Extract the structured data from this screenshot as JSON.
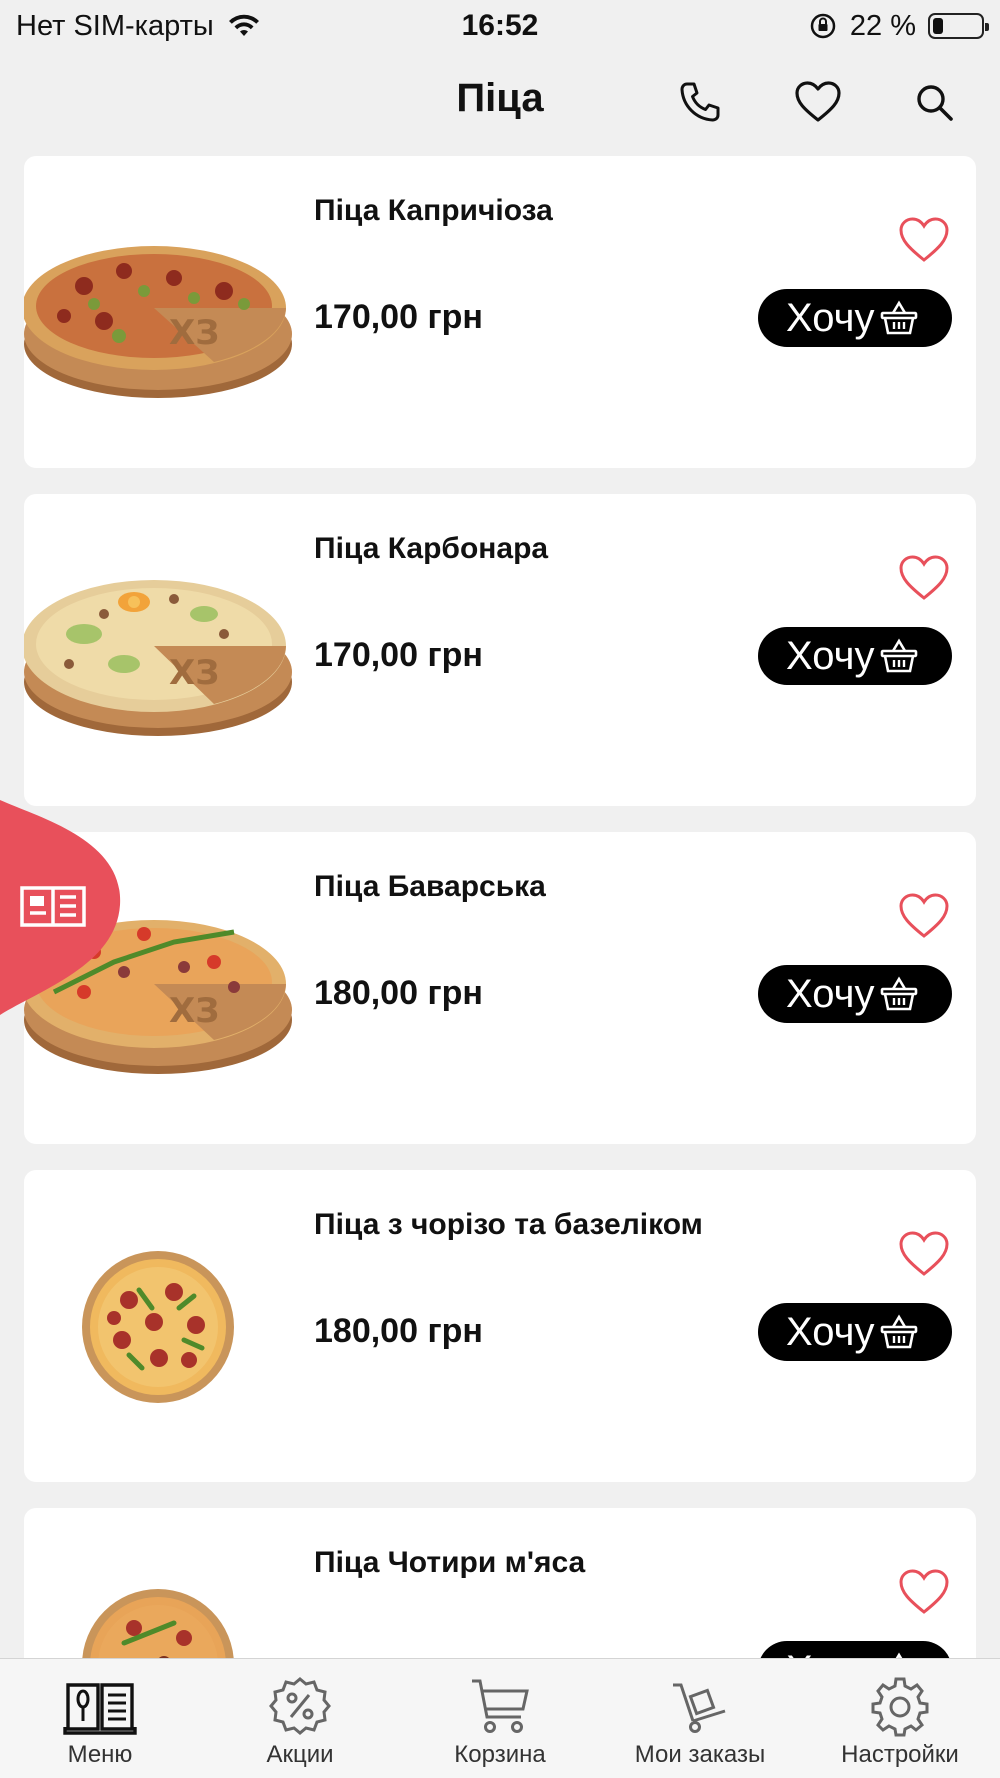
{
  "status_bar": {
    "carrier": "Нет SIM-карты",
    "time": "16:52",
    "battery_text": "22 %",
    "battery_level": 0.22
  },
  "header": {
    "title": "Піца",
    "icons": [
      "phone-icon",
      "heart-icon",
      "search-icon"
    ]
  },
  "products": [
    {
      "name": "Піца Капричіоза",
      "price": "170,00 грн",
      "button_label": "Хочу"
    },
    {
      "name": "Піца Карбонара",
      "price": "170,00 грн",
      "button_label": "Хочу"
    },
    {
      "name": "Піца Баварська",
      "price": "180,00 грн",
      "button_label": "Хочу"
    },
    {
      "name": "Піца з чорізо та базеліком",
      "price": "180,00 грн",
      "button_label": "Хочу"
    },
    {
      "name": "Піца Чотири м'яса",
      "price": "",
      "button_label": "Хочу"
    }
  ],
  "tab_bar": {
    "items": [
      {
        "label": "Меню",
        "icon": "menu-book-icon"
      },
      {
        "label": "Акции",
        "icon": "discount-icon"
      },
      {
        "label": "Корзина",
        "icon": "cart-icon"
      },
      {
        "label": "Мои заказы",
        "icon": "orders-trolley-icon"
      },
      {
        "label": "Настройки",
        "icon": "gear-icon"
      }
    ]
  },
  "colors": {
    "accent": "#e8505b",
    "button_bg": "#000000",
    "background": "#f0f0f0"
  }
}
